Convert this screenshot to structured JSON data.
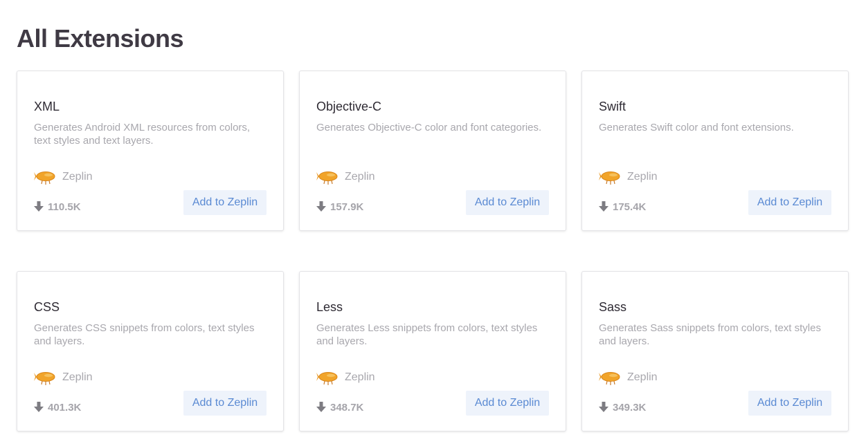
{
  "page": {
    "title": "All Extensions"
  },
  "colors": {
    "title": "#3f3a44",
    "card_title": "#2e2a33",
    "muted_text": "#a8a7ad",
    "button_bg": "#eef3fb",
    "button_text": "#5a8ad3",
    "zeplin_orange": "#f1a42a"
  },
  "extensions": [
    {
      "name": "XML",
      "description": "Generates Android XML resources from colors, text styles and text layers.",
      "author": "Zeplin",
      "author_icon": "zeplin-blimp-icon",
      "downloads": "110.5K",
      "download_icon": "download-arrow-icon",
      "button_label": "Add to Zeplin"
    },
    {
      "name": "Objective-C",
      "description": "Generates Objective-C color and font categories.",
      "author": "Zeplin",
      "author_icon": "zeplin-blimp-icon",
      "downloads": "157.9K",
      "download_icon": "download-arrow-icon",
      "button_label": "Add to Zeplin"
    },
    {
      "name": "Swift",
      "description": "Generates Swift color and font extensions.",
      "author": "Zeplin",
      "author_icon": "zeplin-blimp-icon",
      "downloads": "175.4K",
      "download_icon": "download-arrow-icon",
      "button_label": "Add to Zeplin"
    },
    {
      "name": "CSS",
      "description": "Generates CSS snippets from colors, text styles and layers.",
      "author": "Zeplin",
      "author_icon": "zeplin-blimp-icon",
      "downloads": "401.3K",
      "download_icon": "download-arrow-icon",
      "button_label": "Add to Zeplin"
    },
    {
      "name": "Less",
      "description": "Generates Less snippets from colors, text styles and layers.",
      "author": "Zeplin",
      "author_icon": "zeplin-blimp-icon",
      "downloads": "348.7K",
      "download_icon": "download-arrow-icon",
      "button_label": "Add to Zeplin"
    },
    {
      "name": "Sass",
      "description": "Generates Sass snippets from colors, text styles and layers.",
      "author": "Zeplin",
      "author_icon": "zeplin-blimp-icon",
      "downloads": "349.3K",
      "download_icon": "download-arrow-icon",
      "button_label": "Add to Zeplin"
    }
  ]
}
